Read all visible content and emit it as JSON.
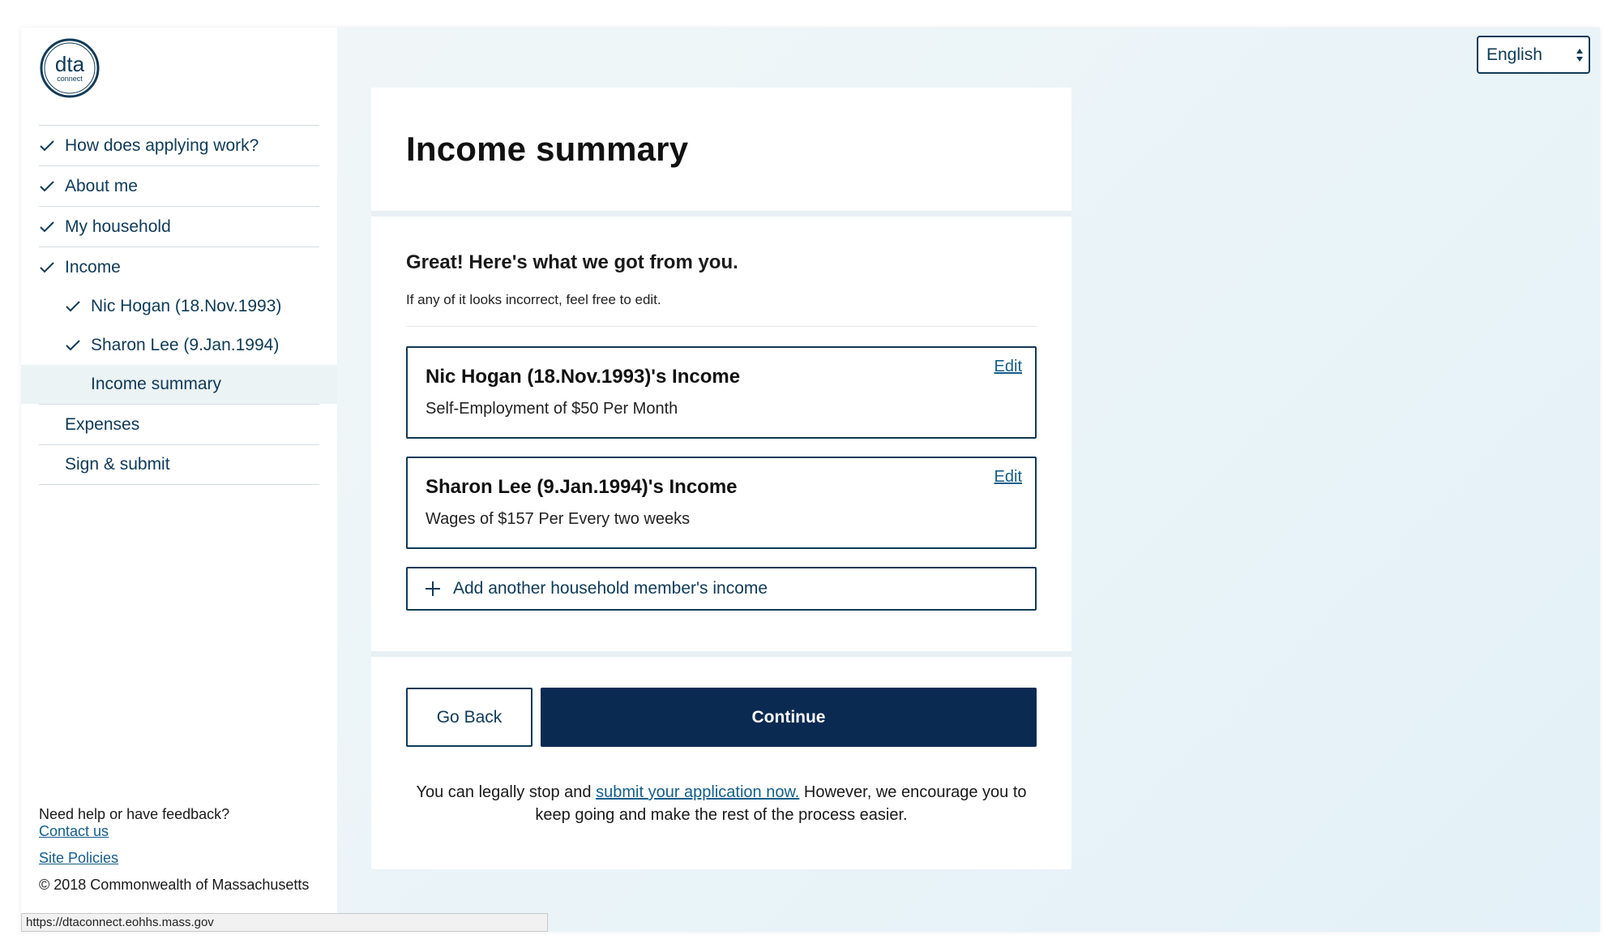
{
  "logo": {
    "main": "dta",
    "sub": "connect"
  },
  "language_select": {
    "value": "English"
  },
  "sidebar": {
    "items": [
      {
        "label": "How does applying work?",
        "done": true
      },
      {
        "label": "About me",
        "done": true
      },
      {
        "label": "My household",
        "done": true
      },
      {
        "label": "Income",
        "done": true
      },
      {
        "label": "Expenses",
        "done": false
      },
      {
        "label": "Sign & submit",
        "done": false
      }
    ],
    "income_subitems": [
      {
        "label": "Nic Hogan (18.Nov.1993)",
        "done": true
      },
      {
        "label": "Sharon Lee (9.Jan.1994)",
        "done": true
      },
      {
        "label": "Income summary",
        "active": true
      }
    ],
    "help_text": "Need help or have feedback?",
    "contact_link": "Contact us",
    "policies_link": "Site Policies",
    "copyright": "© 2018 Commonwealth of Massachusetts"
  },
  "main": {
    "title": "Income summary",
    "heading": "Great! Here's what we got from you.",
    "subtext": "If any of it looks incorrect, feel free to edit.",
    "incomes": [
      {
        "name": "Nic Hogan (18.Nov.1993)'s Income",
        "detail": "Self-Employment of $50 Per Month",
        "edit": "Edit"
      },
      {
        "name": "Sharon Lee (9.Jan.1994)'s Income",
        "detail": "Wages of $157 Per Every two weeks",
        "edit": "Edit"
      }
    ],
    "add_label": "Add another household member's income",
    "back_label": "Go Back",
    "continue_label": "Continue",
    "note_before": "You can legally stop and ",
    "note_link": "submit your application now.",
    "note_after": " However, we encourage you to keep going and make the rest of the process easier."
  },
  "status_bar": {
    "url": "https://dtaconnect.eohhs.mass.gov"
  },
  "colors": {
    "navy": "#0e3a57",
    "continue_bg": "#0b2a52",
    "link": "#135e8a"
  }
}
